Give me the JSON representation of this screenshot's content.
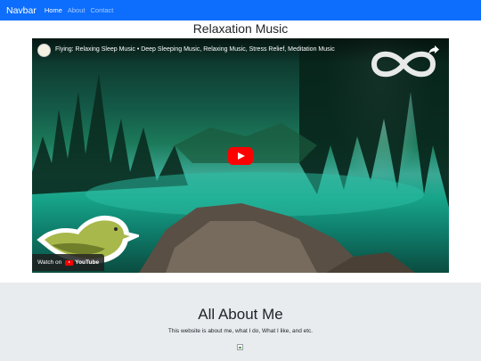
{
  "navbar": {
    "brand": "Navbar",
    "links": [
      {
        "label": "Home",
        "active": true
      },
      {
        "label": "About",
        "active": false
      },
      {
        "label": "Contact",
        "active": false
      }
    ],
    "color": "#0d6efd"
  },
  "main": {
    "title": "Relaxation Music",
    "video": {
      "title": "Flying: Relaxing Sleep Music • Deep Sleeping Music, Relaxing Music, Stress Relief, Meditation Music",
      "watch_on": "Watch on",
      "platform": "YouTube",
      "play_button_color": "#ff0000",
      "icons": [
        "channel-avatar-icon",
        "share-icon",
        "infinity-logo-icon",
        "play-icon",
        "bird-logo-icon"
      ]
    }
  },
  "about": {
    "title": "All About Me",
    "text": "This website is about me, what I do, What I like, and etc.",
    "background": "#e9ecef",
    "image_icon": "broken-image-icon"
  }
}
